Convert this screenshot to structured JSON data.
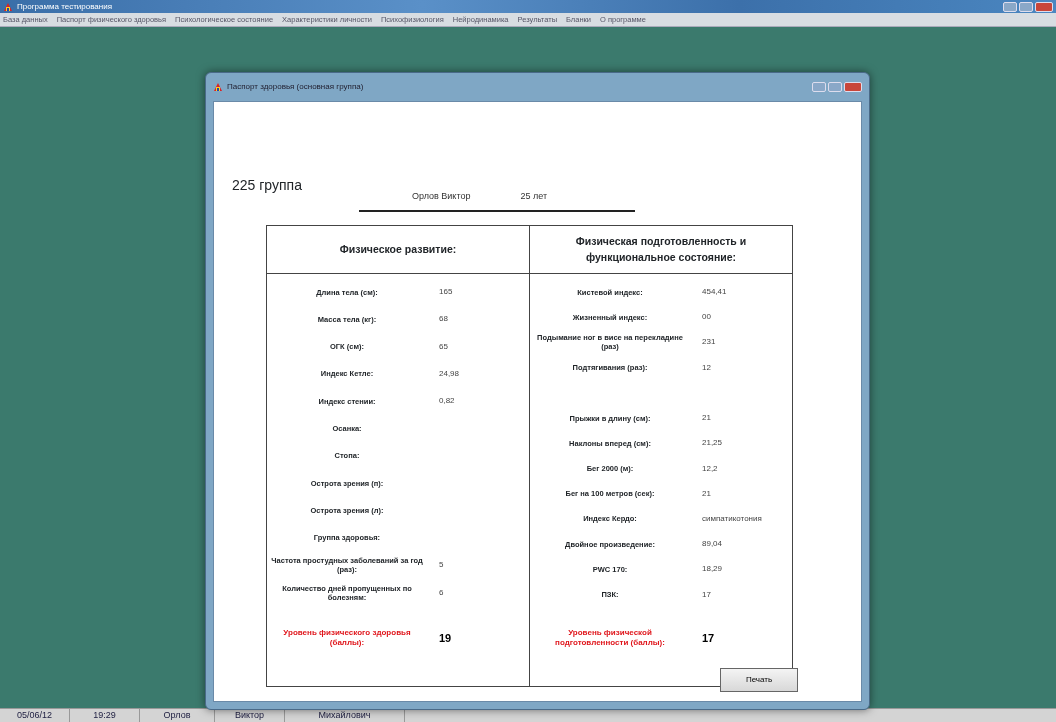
{
  "window": {
    "title": "Программа тестирования"
  },
  "menu": [
    "База данных",
    "Паспорт физического здоровья",
    "Психологическое состояние",
    "Характеристики личности",
    "Психофизиология",
    "Нейродинамика",
    "Результаты",
    "Бланки",
    "О программе"
  ],
  "dialog": {
    "title": "Паспорт здоровья (основная группа)",
    "group": "225 группа",
    "name": "Орлов Виктор",
    "age": "25 лет",
    "columns": [
      {
        "heading": "Физическое развитие:",
        "rows": [
          {
            "kind": "field",
            "label": "Длина тела (см):",
            "value": "165"
          },
          {
            "kind": "field",
            "label": "Масса тела (кг):",
            "value": "68"
          },
          {
            "kind": "field",
            "label": "ОГК (см):",
            "value": "65"
          },
          {
            "kind": "field",
            "label": "Индекс Кетле:",
            "value": "24,98"
          },
          {
            "kind": "field",
            "label": "Индекс стении:",
            "value": "0,82"
          },
          {
            "kind": "field",
            "label": "Осанка:"
          },
          {
            "kind": "field",
            "label": "Стопа:"
          },
          {
            "kind": "field",
            "label": "Острота зрения (п):"
          },
          {
            "kind": "field",
            "label": "Острота зрения (л):"
          },
          {
            "kind": "field",
            "label": "Группа здоровья:"
          },
          {
            "kind": "field",
            "label": "Частота простудных заболеваний за год (раз):",
            "value": "5"
          },
          {
            "kind": "field",
            "label": "Количество дней пропущенных по болезням:",
            "value": "6"
          },
          {
            "kind": "total",
            "label": "Уровень физического здоровья (баллы):",
            "value": "19"
          }
        ]
      },
      {
        "heading": "Физическая  подготовленность и функциональное состояние:",
        "rows": [
          {
            "kind": "field",
            "label": "Кистевой индекс:",
            "value": "454,41"
          },
          {
            "kind": "field",
            "label": "Жизненный индекс:",
            "value": "00"
          },
          {
            "kind": "field",
            "label": "Подымание ног в висе на перекладине (раз)",
            "value": "231"
          },
          {
            "kind": "field",
            "label": "Подтягивания (раз):",
            "value": "12"
          },
          {
            "kind": "gap"
          },
          {
            "kind": "field",
            "label": "Прыжки в длину (см):",
            "value": "21"
          },
          {
            "kind": "field",
            "label": "Наклоны вперед (см):",
            "value": "21,25"
          },
          {
            "kind": "field",
            "label": "Бег 2000 (м):",
            "value": "12,2"
          },
          {
            "kind": "field",
            "label": "Бег на 100 метров (сек):",
            "value": "21"
          },
          {
            "kind": "field",
            "label": "Индекс Кердо:",
            "value": "симпатикотония"
          },
          {
            "kind": "field",
            "label": "Двойное произведение:",
            "value": "89,04"
          },
          {
            "kind": "field",
            "label": "PWC 170:",
            "value": "18,29"
          },
          {
            "kind": "field",
            "label": "ПЗК:",
            "value": "17"
          },
          {
            "kind": "total",
            "label": "Уровень физической подготовленности (баллы):",
            "value": "17"
          }
        ]
      }
    ],
    "print_button": "Печать"
  },
  "status_bar": [
    "05/06/12",
    "19:29",
    "Орлов",
    "Виктор",
    "Михайлович"
  ]
}
